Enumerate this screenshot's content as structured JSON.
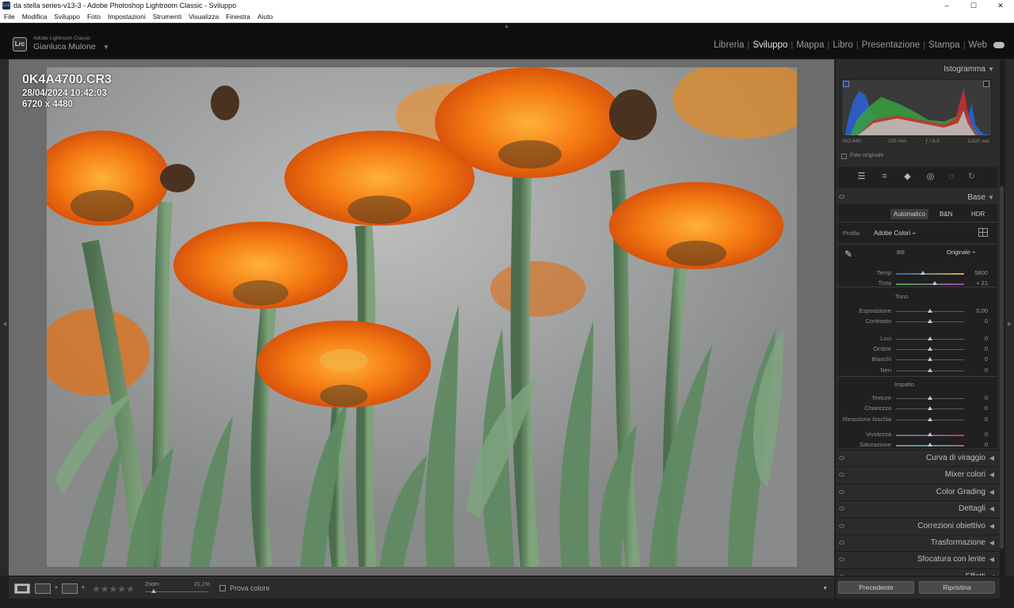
{
  "window": {
    "title": "da stella series-v13-3 - Adobe Photoshop Lightroom Classic - Sviluppo",
    "app_icon_text": "Lrc",
    "controls": [
      "–",
      "☐",
      "✕"
    ]
  },
  "menu": [
    "File",
    "Modifica",
    "Sviluppo",
    "Foto",
    "Impostazioni",
    "Strumenti",
    "Visualizza",
    "Finestra",
    "Aiuto"
  ],
  "identity": {
    "badge": "Lrc",
    "product": "Adobe Lightroom Classic",
    "user": "Gianluca Mulone",
    "caret": "▼"
  },
  "modules": [
    {
      "label": "Libreria",
      "active": false
    },
    {
      "label": "Sviluppo",
      "active": true
    },
    {
      "label": "Mappa",
      "active": false
    },
    {
      "label": "Libro",
      "active": false
    },
    {
      "label": "Presentazione",
      "active": false
    },
    {
      "label": "Stampa",
      "active": false
    },
    {
      "label": "Web",
      "active": false
    }
  ],
  "photo_info": {
    "filename": "0K4A4700.CR3",
    "datetime": "28/04/2024 10:42:03",
    "dimensions": "6720 x 4480"
  },
  "toolbar": {
    "stars": "★★★★★",
    "zoom_label": "Zoom",
    "zoom_value": "21,1%",
    "proof_label": "Prova colore",
    "menu_arrow": "▼"
  },
  "histogram": {
    "title": "Istogramma",
    "iso": "ISO 640",
    "focal": "105 mm",
    "aperture": "ƒ / 8,0",
    "shutter": "1/320 sec",
    "original_label": "Foto originale"
  },
  "tools": [
    "☰",
    "⌗",
    "◆",
    "◎",
    "◌",
    "↻"
  ],
  "base": {
    "title": "Base",
    "buttons": [
      "Automatico",
      "B&N",
      "HDR"
    ],
    "profile_label": "Profilo",
    "profile_value": "Adobe Colori ÷",
    "wb_label": "BB",
    "wb_value": "Originale ÷",
    "tone_label": "Tono",
    "presence_label": "Impatto",
    "sliders": [
      {
        "name": "Temp",
        "value": "5800",
        "pos": 0.4,
        "kind": "temp"
      },
      {
        "name": "Tinta",
        "value": "+ 21",
        "pos": 0.57,
        "kind": "tint"
      },
      {
        "name": "Esposizione",
        "value": "0,00",
        "pos": 0.5,
        "kind": "plain"
      },
      {
        "name": "Contrasto",
        "value": "0",
        "pos": 0.5,
        "kind": "plain"
      },
      {
        "name": "Luci",
        "value": "0",
        "pos": 0.5,
        "kind": "plain"
      },
      {
        "name": "Ombre",
        "value": "0",
        "pos": 0.5,
        "kind": "plain"
      },
      {
        "name": "Bianchi",
        "value": "0",
        "pos": 0.5,
        "kind": "plain"
      },
      {
        "name": "Neri",
        "value": "0",
        "pos": 0.5,
        "kind": "plain"
      },
      {
        "name": "Texture",
        "value": "0",
        "pos": 0.5,
        "kind": "plain"
      },
      {
        "name": "Chiarezza",
        "value": "0",
        "pos": 0.5,
        "kind": "plain"
      },
      {
        "name": "Rimozione foschia",
        "value": "0",
        "pos": 0.5,
        "kind": "plain"
      },
      {
        "name": "Vividezza",
        "value": "0",
        "pos": 0.5,
        "kind": "vib"
      },
      {
        "name": "Saturazione",
        "value": "0",
        "pos": 0.5,
        "kind": "sat"
      }
    ]
  },
  "sections": [
    "Curva di viraggio",
    "Mixer colori",
    "Color Grading",
    "Dettagli",
    "Correzioni obiettivo",
    "Trasformazione",
    "Sfocatura con lente",
    "Effetti"
  ],
  "footer_buttons": [
    "Precedente",
    "Ripristina"
  ],
  "icons": {
    "collapse": "▼",
    "expand": "◀",
    "edge_left": "◀",
    "edge_right": "▶",
    "top": "▲",
    "picker": "✎"
  }
}
